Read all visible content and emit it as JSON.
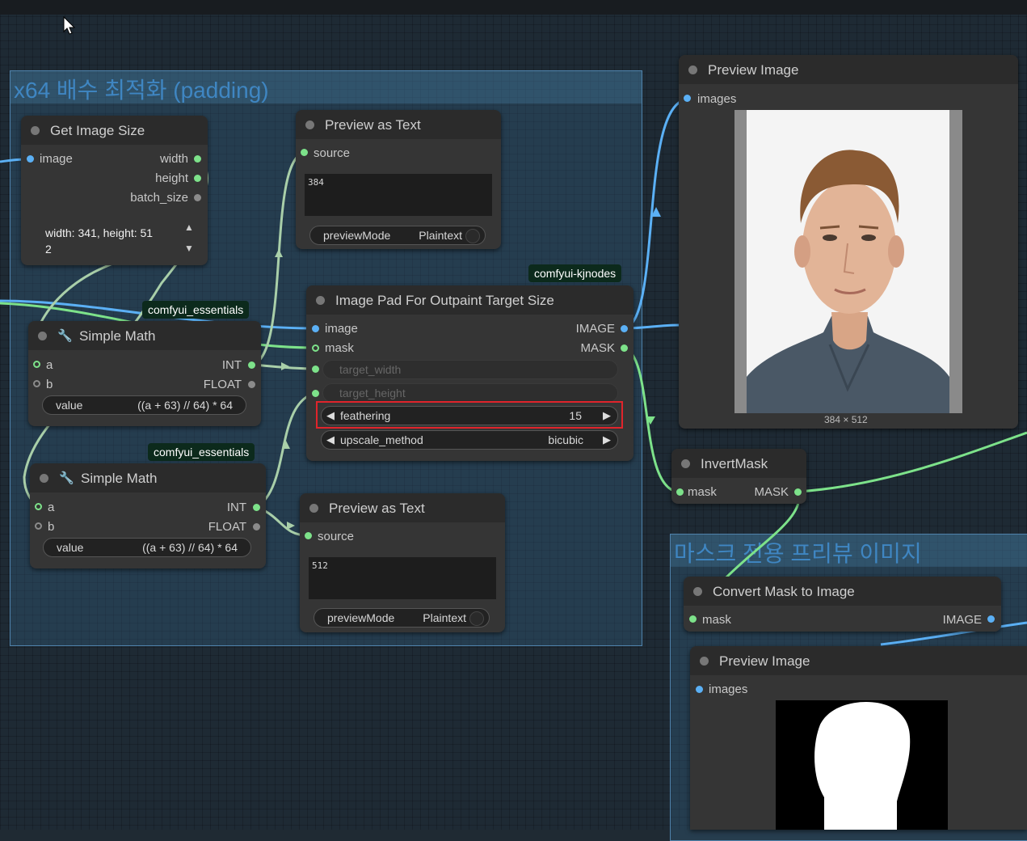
{
  "groups": {
    "padding": {
      "title": "x64 배수 최적화 (padding)"
    },
    "mask_preview": {
      "title": "마스크 전용 프리뷰 이미지"
    }
  },
  "badges": {
    "kjnodes": "comfyui-kjnodes",
    "essentials_1": "comfyui_essentials",
    "essentials_2": "comfyui_essentials"
  },
  "nodes": {
    "get_image_size": {
      "title": "Get Image Size",
      "input_image": "image",
      "out_width": "width",
      "out_height": "height",
      "out_batch": "batch_size",
      "info_line1": "width: 341, height: 51",
      "info_line2": "2"
    },
    "preview_text_1": {
      "title": "Preview as Text",
      "input_source": "source",
      "text": "384",
      "mode_label": "previewMode",
      "mode_value": "Plaintext"
    },
    "preview_text_2": {
      "title": "Preview as Text",
      "input_source": "source",
      "text": "512",
      "mode_label": "previewMode",
      "mode_value": "Plaintext"
    },
    "simple_math_1": {
      "title": "Simple Math",
      "in_a": "a",
      "in_b": "b",
      "out_int": "INT",
      "out_float": "FLOAT",
      "value_label": "value",
      "value": "((a + 63) // 64) * 64"
    },
    "simple_math_2": {
      "title": "Simple Math",
      "in_a": "a",
      "in_b": "b",
      "out_int": "INT",
      "out_float": "FLOAT",
      "value_label": "value",
      "value": "((a + 63) // 64) * 64"
    },
    "image_pad": {
      "title": "Image Pad For Outpaint Target Size",
      "in_image": "image",
      "in_mask": "mask",
      "out_image": "IMAGE",
      "out_mask": "MASK",
      "target_width": "target_width",
      "target_height": "target_height",
      "feathering_label": "feathering",
      "feathering_value": "15",
      "upscale_label": "upscale_method",
      "upscale_value": "bicubic"
    },
    "preview_image_1": {
      "title": "Preview Image",
      "input": "images",
      "dims": "384 × 512"
    },
    "invert_mask": {
      "title": "InvertMask",
      "input": "mask",
      "output": "MASK"
    },
    "convert_mask": {
      "title": "Convert Mask to Image",
      "input": "mask",
      "output": "IMAGE"
    },
    "preview_image_2": {
      "title": "Preview Image",
      "input": "images"
    }
  },
  "colors": {
    "image_wire": "#5bb0f5",
    "mask_wire": "#7de28a",
    "int_wire": "#a9cfa9",
    "highlight": "#e0242b",
    "group_title": "#3f86c2"
  }
}
